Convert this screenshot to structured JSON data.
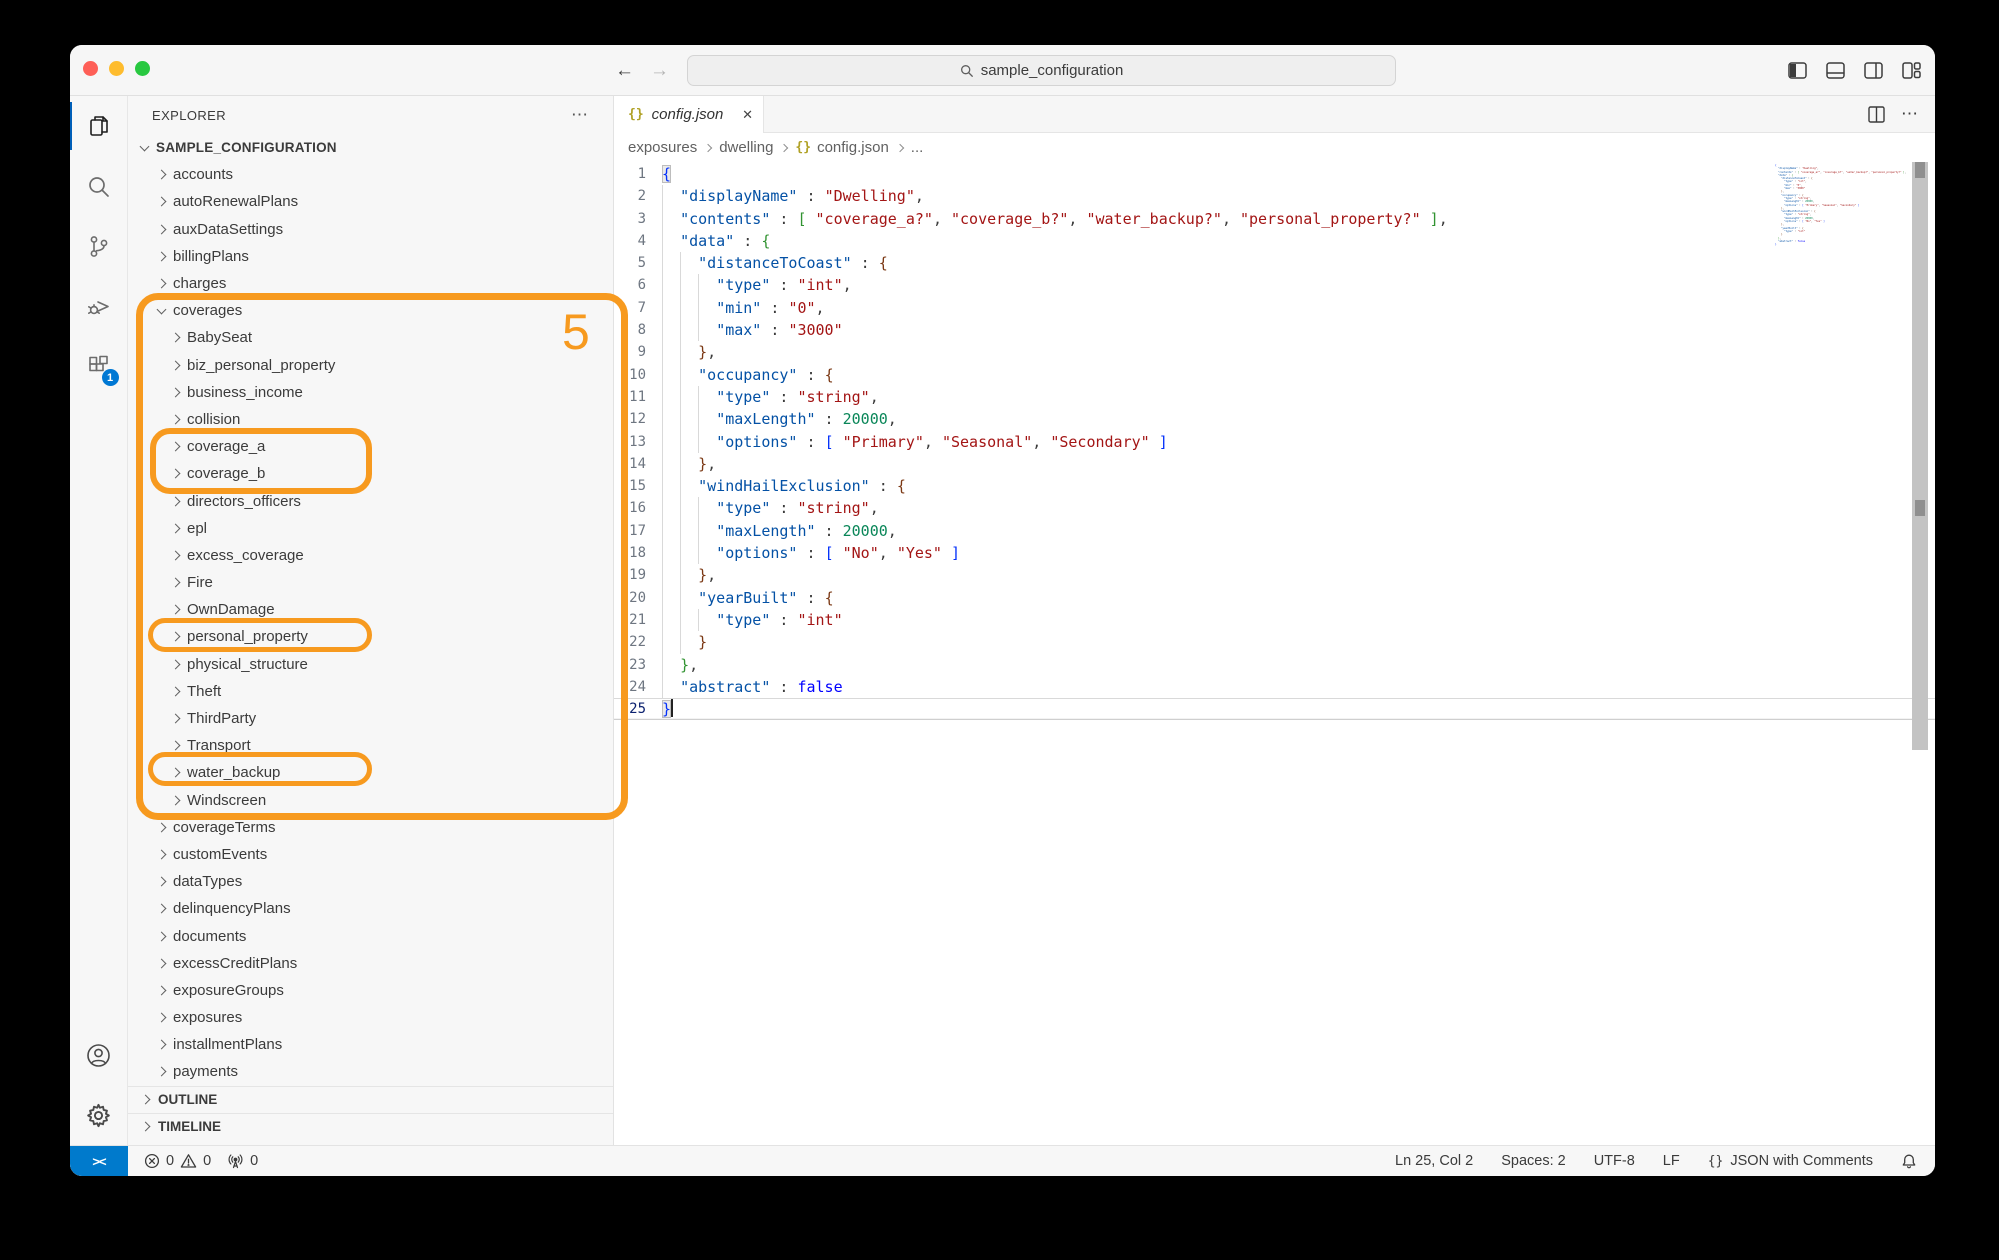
{
  "titlebar": {
    "search_text": "sample_configuration"
  },
  "icons": {
    "close": "✕",
    "more": "⋯",
    "braces": "{}",
    "back": "←",
    "forward": "→"
  },
  "activity_bar": {
    "items": [
      "explorer",
      "search",
      "source-control",
      "run-debug",
      "extensions"
    ],
    "extensions_badge": "1"
  },
  "sidebar": {
    "header": "EXPLORER",
    "sections": [
      "OUTLINE",
      "TIMELINE"
    ],
    "tree": [
      {
        "label": "SAMPLE_CONFIGURATION",
        "depth": 0,
        "expanded": true,
        "root": true
      },
      {
        "label": "accounts",
        "depth": 1
      },
      {
        "label": "autoRenewalPlans",
        "depth": 1
      },
      {
        "label": "auxDataSettings",
        "depth": 1
      },
      {
        "label": "billingPlans",
        "depth": 1
      },
      {
        "label": "charges",
        "depth": 1
      },
      {
        "label": "coverages",
        "depth": 1,
        "expanded": true
      },
      {
        "label": "BabySeat",
        "depth": 2
      },
      {
        "label": "biz_personal_property",
        "depth": 2
      },
      {
        "label": "business_income",
        "depth": 2
      },
      {
        "label": "collision",
        "depth": 2
      },
      {
        "label": "coverage_a",
        "depth": 2
      },
      {
        "label": "coverage_b",
        "depth": 2
      },
      {
        "label": "directors_officers",
        "depth": 2
      },
      {
        "label": "epl",
        "depth": 2
      },
      {
        "label": "excess_coverage",
        "depth": 2
      },
      {
        "label": "Fire",
        "depth": 2
      },
      {
        "label": "OwnDamage",
        "depth": 2
      },
      {
        "label": "personal_property",
        "depth": 2
      },
      {
        "label": "physical_structure",
        "depth": 2
      },
      {
        "label": "Theft",
        "depth": 2
      },
      {
        "label": "ThirdParty",
        "depth": 2
      },
      {
        "label": "Transport",
        "depth": 2
      },
      {
        "label": "water_backup",
        "depth": 2
      },
      {
        "label": "Windscreen",
        "depth": 2
      },
      {
        "label": "coverageTerms",
        "depth": 1
      },
      {
        "label": "customEvents",
        "depth": 1
      },
      {
        "label": "dataTypes",
        "depth": 1
      },
      {
        "label": "delinquencyPlans",
        "depth": 1
      },
      {
        "label": "documents",
        "depth": 1
      },
      {
        "label": "excessCreditPlans",
        "depth": 1
      },
      {
        "label": "exposureGroups",
        "depth": 1
      },
      {
        "label": "exposures",
        "depth": 1
      },
      {
        "label": "installmentPlans",
        "depth": 1
      },
      {
        "label": "payments",
        "depth": 1
      }
    ]
  },
  "editor": {
    "tab": {
      "name": "config.json"
    },
    "breadcrumbs": [
      {
        "label": "exposures"
      },
      {
        "label": "dwelling"
      },
      {
        "label": "config.json",
        "icon": true
      },
      {
        "label": "..."
      }
    ],
    "active_line": 25,
    "code": {
      "lines": [
        [
          [
            "b1",
            "{",
            "m"
          ]
        ],
        [
          [
            "p",
            "  "
          ],
          [
            "k",
            "\"displayName\""
          ],
          [
            "p",
            " : "
          ],
          [
            "s",
            "\"Dwelling\""
          ],
          [
            "p",
            ","
          ]
        ],
        [
          [
            "p",
            "  "
          ],
          [
            "k",
            "\"contents\""
          ],
          [
            "p",
            " : "
          ],
          [
            "b2",
            "["
          ],
          [
            "p",
            " "
          ],
          [
            "s",
            "\"coverage_a?\""
          ],
          [
            "p",
            ", "
          ],
          [
            "s",
            "\"coverage_b?\""
          ],
          [
            "p",
            ", "
          ],
          [
            "s",
            "\"water_backup?\""
          ],
          [
            "p",
            ", "
          ],
          [
            "s",
            "\"personal_property?\""
          ],
          [
            "p",
            " "
          ],
          [
            "b2",
            "]"
          ],
          [
            "p",
            ","
          ]
        ],
        [
          [
            "p",
            "  "
          ],
          [
            "k",
            "\"data\""
          ],
          [
            "p",
            " : "
          ],
          [
            "b2",
            "{"
          ]
        ],
        [
          [
            "p",
            "    "
          ],
          [
            "k",
            "\"distanceToCoast\""
          ],
          [
            "p",
            " : "
          ],
          [
            "b3",
            "{"
          ]
        ],
        [
          [
            "p",
            "      "
          ],
          [
            "k",
            "\"type\""
          ],
          [
            "p",
            " : "
          ],
          [
            "s",
            "\"int\""
          ],
          [
            "p",
            ","
          ]
        ],
        [
          [
            "p",
            "      "
          ],
          [
            "k",
            "\"min\""
          ],
          [
            "p",
            " : "
          ],
          [
            "s",
            "\"0\""
          ],
          [
            "p",
            ","
          ]
        ],
        [
          [
            "p",
            "      "
          ],
          [
            "k",
            "\"max\""
          ],
          [
            "p",
            " : "
          ],
          [
            "s",
            "\"3000\""
          ]
        ],
        [
          [
            "p",
            "    "
          ],
          [
            "b3",
            "}"
          ],
          [
            "p",
            ","
          ]
        ],
        [
          [
            "p",
            "    "
          ],
          [
            "k",
            "\"occupancy\""
          ],
          [
            "p",
            " : "
          ],
          [
            "b3",
            "{"
          ]
        ],
        [
          [
            "p",
            "      "
          ],
          [
            "k",
            "\"type\""
          ],
          [
            "p",
            " : "
          ],
          [
            "s",
            "\"string\""
          ],
          [
            "p",
            ","
          ]
        ],
        [
          [
            "p",
            "      "
          ],
          [
            "k",
            "\"maxLength\""
          ],
          [
            "p",
            " : "
          ],
          [
            "n",
            "20000"
          ],
          [
            "p",
            ","
          ]
        ],
        [
          [
            "p",
            "      "
          ],
          [
            "k",
            "\"options\""
          ],
          [
            "p",
            " : "
          ],
          [
            "b1",
            "["
          ],
          [
            "p",
            " "
          ],
          [
            "s",
            "\"Primary\""
          ],
          [
            "p",
            ", "
          ],
          [
            "s",
            "\"Seasonal\""
          ],
          [
            "p",
            ", "
          ],
          [
            "s",
            "\"Secondary\""
          ],
          [
            "p",
            " "
          ],
          [
            "b1",
            "]"
          ]
        ],
        [
          [
            "p",
            "    "
          ],
          [
            "b3",
            "}"
          ],
          [
            "p",
            ","
          ]
        ],
        [
          [
            "p",
            "    "
          ],
          [
            "k",
            "\"windHailExclusion\""
          ],
          [
            "p",
            " : "
          ],
          [
            "b3",
            "{"
          ]
        ],
        [
          [
            "p",
            "      "
          ],
          [
            "k",
            "\"type\""
          ],
          [
            "p",
            " : "
          ],
          [
            "s",
            "\"string\""
          ],
          [
            "p",
            ","
          ]
        ],
        [
          [
            "p",
            "      "
          ],
          [
            "k",
            "\"maxLength\""
          ],
          [
            "p",
            " : "
          ],
          [
            "n",
            "20000"
          ],
          [
            "p",
            ","
          ]
        ],
        [
          [
            "p",
            "      "
          ],
          [
            "k",
            "\"options\""
          ],
          [
            "p",
            " : "
          ],
          [
            "b1",
            "["
          ],
          [
            "p",
            " "
          ],
          [
            "s",
            "\"No\""
          ],
          [
            "p",
            ", "
          ],
          [
            "s",
            "\"Yes\""
          ],
          [
            "p",
            " "
          ],
          [
            "b1",
            "]"
          ]
        ],
        [
          [
            "p",
            "    "
          ],
          [
            "b3",
            "}"
          ],
          [
            "p",
            ","
          ]
        ],
        [
          [
            "p",
            "    "
          ],
          [
            "k",
            "\"yearBuilt\""
          ],
          [
            "p",
            " : "
          ],
          [
            "b3",
            "{"
          ]
        ],
        [
          [
            "p",
            "      "
          ],
          [
            "k",
            "\"type\""
          ],
          [
            "p",
            " : "
          ],
          [
            "s",
            "\"int\""
          ]
        ],
        [
          [
            "p",
            "    "
          ],
          [
            "b3",
            "}"
          ]
        ],
        [
          [
            "p",
            "  "
          ],
          [
            "b2",
            "}"
          ],
          [
            "p",
            ","
          ]
        ],
        [
          [
            "p",
            "  "
          ],
          [
            "k",
            "\"abstract\""
          ],
          [
            "p",
            " : "
          ],
          [
            "w",
            "false"
          ]
        ],
        [
          [
            "b1",
            "}",
            "m"
          ]
        ]
      ]
    }
  },
  "status_bar": {
    "remote": "><",
    "errors": "0",
    "warnings": "0",
    "ports": "0",
    "line_col": "Ln 25, Col 2",
    "indent": "Spaces: 2",
    "encoding": "UTF-8",
    "eol": "LF",
    "language": "JSON with Comments"
  },
  "annotations": {
    "color": "#F79A1F",
    "count_label": "5"
  }
}
